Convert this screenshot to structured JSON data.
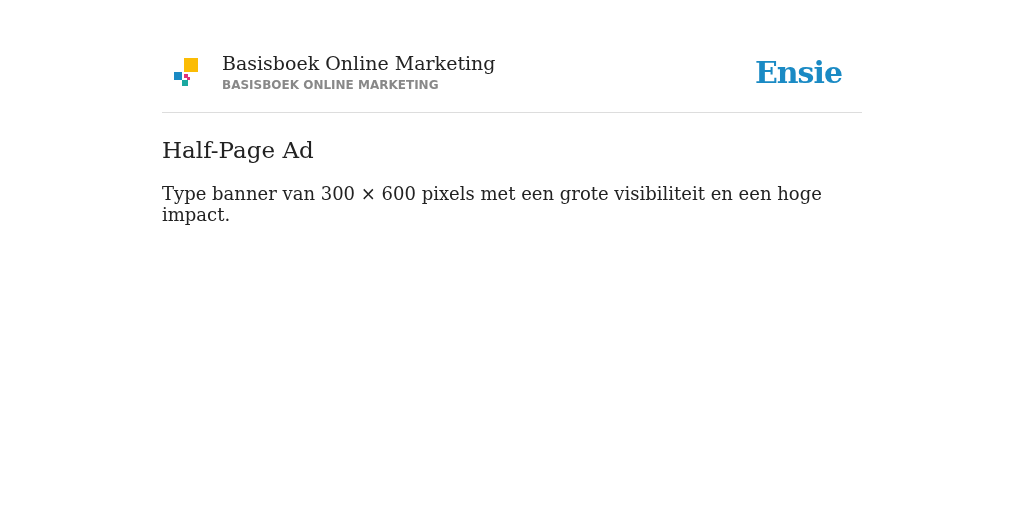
{
  "header": {
    "title": "Basisboek Online Marketing",
    "subtitle": "BASISBOEK ONLINE MARKETING",
    "brand": "Ensie"
  },
  "article": {
    "heading": "Half-Page Ad",
    "body": "Type banner van 300 × 600 pixels met een grote visibiliteit en een hoge impact."
  }
}
